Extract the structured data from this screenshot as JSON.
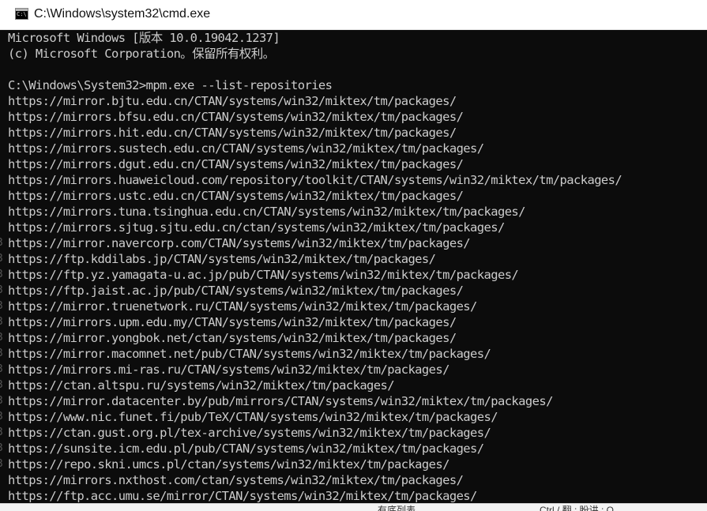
{
  "window": {
    "title": "C:\\Windows\\system32\\cmd.exe",
    "icon": "cmd-icon",
    "icon_glyph": "C:\\"
  },
  "console": {
    "lines": [
      "Microsoft Windows [版本 10.0.19042.1237]",
      "(c) Microsoft Corporation。保留所有权利。",
      "",
      "C:\\Windows\\System32>mpm.exe --list-repositories",
      "https://mirror.bjtu.edu.cn/CTAN/systems/win32/miktex/tm/packages/",
      "https://mirrors.bfsu.edu.cn/CTAN/systems/win32/miktex/tm/packages/",
      "https://mirrors.hit.edu.cn/CTAN/systems/win32/miktex/tm/packages/",
      "https://mirrors.sustech.edu.cn/CTAN/systems/win32/miktex/tm/packages/",
      "https://mirrors.dgut.edu.cn/CTAN/systems/win32/miktex/tm/packages/",
      "https://mirrors.huaweicloud.com/repository/toolkit/CTAN/systems/win32/miktex/tm/packages/",
      "https://mirrors.ustc.edu.cn/CTAN/systems/win32/miktex/tm/packages/",
      "https://mirrors.tuna.tsinghua.edu.cn/CTAN/systems/win32/miktex/tm/packages/",
      "https://mirrors.sjtug.sjtu.edu.cn/ctan/systems/win32/miktex/tm/packages/",
      "https://mirror.navercorp.com/CTAN/systems/win32/miktex/tm/packages/",
      "https://ftp.kddilabs.jp/CTAN/systems/win32/miktex/tm/packages/",
      "https://ftp.yz.yamagata-u.ac.jp/pub/CTAN/systems/win32/miktex/tm/packages/",
      "https://ftp.jaist.ac.jp/pub/CTAN/systems/win32/miktex/tm/packages/",
      "https://mirror.truenetwork.ru/CTAN/systems/win32/miktex/tm/packages/",
      "https://mirrors.upm.edu.my/CTAN/systems/win32/miktex/tm/packages/",
      "https://mirror.yongbok.net/ctan/systems/win32/miktex/tm/packages/",
      "https://mirror.macomnet.net/pub/CTAN/systems/win32/miktex/tm/packages/",
      "https://mirrors.mi-ras.ru/CTAN/systems/win32/miktex/tm/packages/",
      "https://ctan.altspu.ru/systems/win32/miktex/tm/packages/",
      "https://mirror.datacenter.by/pub/mirrors/CTAN/systems/win32/miktex/tm/packages/",
      "https://www.nic.funet.fi/pub/TeX/CTAN/systems/win32/miktex/tm/packages/",
      "https://ctan.gust.org.pl/tex-archive/systems/win32/miktex/tm/packages/",
      "https://sunsite.icm.edu.pl/pub/CTAN/systems/win32/miktex/tm/packages/",
      "https://repo.skni.umcs.pl/ctan/systems/win32/miktex/tm/packages/",
      "https://mirrors.nxthost.com/ctan/systems/win32/miktex/tm/packages/",
      "https://ftp.acc.umu.se/mirror/CTAN/systems/win32/miktex/tm/packages/"
    ],
    "text_color": "#cccccc",
    "background_color": "#0c0c0c"
  },
  "background_window": {
    "strip_glyphs": [
      "3",
      "3",
      "3",
      "3",
      "3",
      "3",
      "3",
      "3",
      "3",
      "3",
      "3",
      "3",
      "3",
      "3",
      "3"
    ],
    "bottom_texts": [
      "有底列表",
      "Ctrl / 翻 ; 盼讲 ; Q"
    ]
  }
}
